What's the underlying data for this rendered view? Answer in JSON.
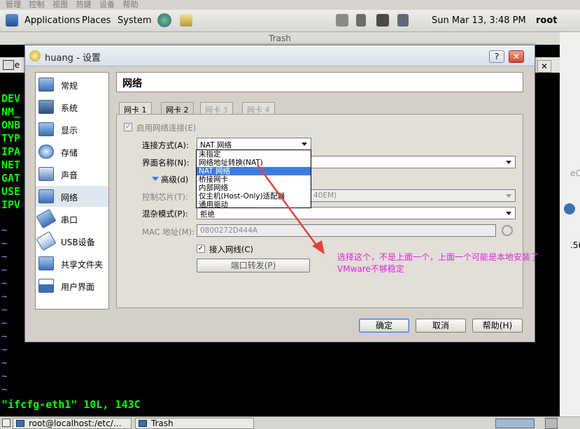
{
  "host_menu": [
    "管理",
    "控制",
    "视图",
    "热键",
    "设备",
    "帮助"
  ],
  "panel": {
    "applications": "Applications",
    "places": "Places",
    "system": "System",
    "clock": "Sun Mar 13,  3:48 PM",
    "user": "root"
  },
  "trash_title": "Trash",
  "terminal": {
    "menu_file": "File",
    "left_labels": [
      "DEV",
      "NM_",
      "ONB",
      "TYP",
      "IPA",
      "NET",
      "GAT",
      "USE",
      "IPV"
    ],
    "tilde": "~",
    "status_line": "\"ifcfg-eth1\" 10L, 143C"
  },
  "right_window": {
    "text1": "eC",
    "text2": ".56"
  },
  "dialog": {
    "title": "huang - 设置",
    "help_btn": "?",
    "close_btn": "✕",
    "sidebar": [
      {
        "label": "常规",
        "icon": "monitor-icon"
      },
      {
        "label": "系统",
        "icon": "chip-icon"
      },
      {
        "label": "显示",
        "icon": "display-icon"
      },
      {
        "label": "存储",
        "icon": "disk-icon"
      },
      {
        "label": "声音",
        "icon": "speaker-icon"
      },
      {
        "label": "网络",
        "icon": "network-icon"
      },
      {
        "label": "串口",
        "icon": "serial-icon"
      },
      {
        "label": "USB设备",
        "icon": "usb-icon"
      },
      {
        "label": "共享文件夹",
        "icon": "folder-icon"
      },
      {
        "label": "用户界面",
        "icon": "window-icon"
      }
    ],
    "selected_section": "网络",
    "header": "网络",
    "tabs": [
      "网卡 1",
      "网卡 2",
      "网卡 3",
      "网卡 4"
    ],
    "enable_adapter": "启用网络连接(E)",
    "attached_label": "连接方式(A):",
    "attached_value": "NAT 网络",
    "name_label": "界面名称(N):",
    "advanced_label": "高级(d)",
    "adapter_type_label": "控制芯片(T):",
    "adapter_type_value": "40EM)",
    "promisc_label": "混杂模式(P):",
    "promisc_value": "拒绝",
    "mac_label": "MAC 地址(M):",
    "mac_value": "0800272D444A",
    "cable_label": "接入网线(C)",
    "port_forward": "端口转发(P)",
    "dropdown_options": [
      "未指定",
      "网络地址转换(NAT)",
      "NAT 网络",
      "桥接网卡",
      "内部网络",
      "仅主机(Host-Only)适配器",
      "通用驱动"
    ],
    "dropdown_selected": "NAT 网络",
    "ok": "确定",
    "cancel": "取消",
    "help": "帮助(H)"
  },
  "annotation": {
    "line1": "选择这个，不是上面一个，上面一个可能是本地安装了",
    "line2": "VMware不够稳定",
    "arrow_color": "#e8403a",
    "text_color": "#e020e0"
  },
  "taskbar": {
    "task1": "root@localhost:/etc/…",
    "task2": "Trash"
  }
}
